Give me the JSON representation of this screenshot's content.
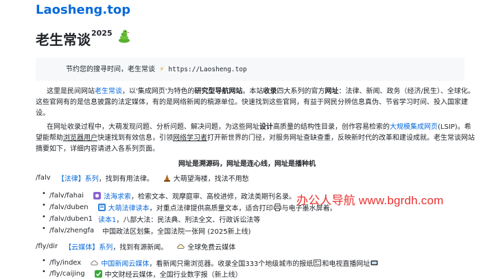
{
  "header": {
    "site_link": "Laosheng.top",
    "title": "老生常谈",
    "title_sup": "2025",
    "title_icon": "snake-icon"
  },
  "codebox": {
    "text": "节约您的搜寻时间，老生常谈",
    "bolt_icon": "lightning-icon",
    "url": "https://Laosheng.top"
  },
  "intro1": {
    "t1": "这里是民间网站",
    "link1": "老生常谈",
    "t2": "，以'集成网页'为特色的",
    "b1": "研究型导航网站",
    "t3": "。本站",
    "b2": "收录",
    "t4": "四大系列的官方",
    "b3": "网址",
    "t5": "：法律、新闻、政务（经济/民生）、全球化。这些官网有的是信息披露的法定媒体，有的是网络新闻的稿源单位。快速找到这些官网，有益于网民分辨信息真伪、节省学习时间、投入国家建设。"
  },
  "intro2": {
    "t1": "在网址收录过程中，大萌发现问题、分析问题、解决问题，为这些网址",
    "b1": "设计",
    "t2": "高质量的结构性目录，创作容易检索的",
    "link1": "大规模集成网页",
    "t3": "(LSIP)。希望能帮助",
    "u1": "浏览器用户",
    "t4": "快速找到有效信息，引领",
    "u2": "网络学习者",
    "t5": "打开新世界的门径，对服务网址查缺查重，反映新时代的改革和建设成就。老生常谈网站摘要如下，详细内容请进入各系列页面。"
  },
  "motto": "网址是溯源码，网址是连心线，网址是播种机",
  "sections": [
    {
      "path": "/falv",
      "tag": "【法律】系列",
      "desc": "，找到有用法律。",
      "extra_icon": "watchtower-icon",
      "extra": "大萌望海楼，找法不用愁",
      "items": [
        {
          "path": "/falv/fahai",
          "icon": "gem-icon",
          "link": "法海求索",
          "desc": "，检索文本、观摩庭审、高校进修，政法类期刊名录。"
        },
        {
          "path": "/falv/duben",
          "icon": "book-icon",
          "link": "大萌法律读本",
          "desc": "，对重点法律提供高质量文本，适合打印",
          "desc2": "与电子墨水屏着。"
        },
        {
          "path": "/falv/duben1",
          "icon": "",
          "link": "读本1",
          "desc": "，八部大法：民法典、刑法全文、行政诉讼法等"
        },
        {
          "path": "/falv/zhengfa",
          "icon": "",
          "link": "",
          "desc": "中国政法区划集，全国法院一张网 (2025新上线)"
        }
      ]
    },
    {
      "path": "/fly/dir",
      "tag": "【云媒体】系列",
      "desc": "，找到有源新闻。",
      "extra_icon": "cloud-icon",
      "extra": "全球免费云媒体",
      "items": [
        {
          "path": "/fly/index",
          "icon": "cloud-icon",
          "link": "中国新闻云媒体",
          "desc": "，看新闻只需浏览器。收录全国333个地级城市的报纸",
          "desc2": "和电视直播网址"
        },
        {
          "path": "/fly/caijing",
          "icon": "check-icon",
          "link": "",
          "desc": "中文财经云媒体，全国行业数字报（新上线）"
        }
      ]
    }
  ],
  "watermark": "办公人导航  www.bgrdh.com",
  "colors": {
    "link": "#0969da",
    "watermark": "#e8312f",
    "codebox_bg": "#f6f8fa"
  }
}
